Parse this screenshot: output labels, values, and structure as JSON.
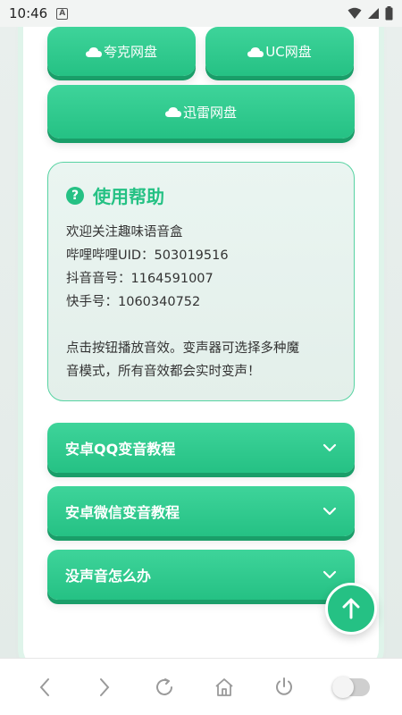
{
  "status_bar": {
    "time": "10:46",
    "badge": "A"
  },
  "cloud_buttons": {
    "kuake": "夸克网盘",
    "uc": "UC网盘",
    "xunlei": "迅雷网盘"
  },
  "help": {
    "icon": "?",
    "title": "使用帮助",
    "lines": [
      "欢迎关注趣味语音盒",
      "哔哩哔哩UID：503019516",
      "抖音音号：1164591007",
      "快手号：1060340752",
      "",
      "点击按钮播放音效。变声器可选择多种魔",
      "音模式，所有音效都会实时变声！"
    ]
  },
  "accordions": [
    {
      "label": "安卓QQ变音教程"
    },
    {
      "label": "安卓微信变音教程"
    },
    {
      "label": "没声音怎么办"
    }
  ],
  "colors": {
    "accent": "#25c184",
    "accent_shadow": "#1a9e69",
    "help_border": "#57d3a2"
  },
  "icons": [
    "cloud-icon",
    "question-icon",
    "chevron-down-icon",
    "arrow-up-icon",
    "back-icon",
    "forward-icon",
    "refresh-icon",
    "home-icon",
    "power-icon",
    "toggle-switch"
  ]
}
